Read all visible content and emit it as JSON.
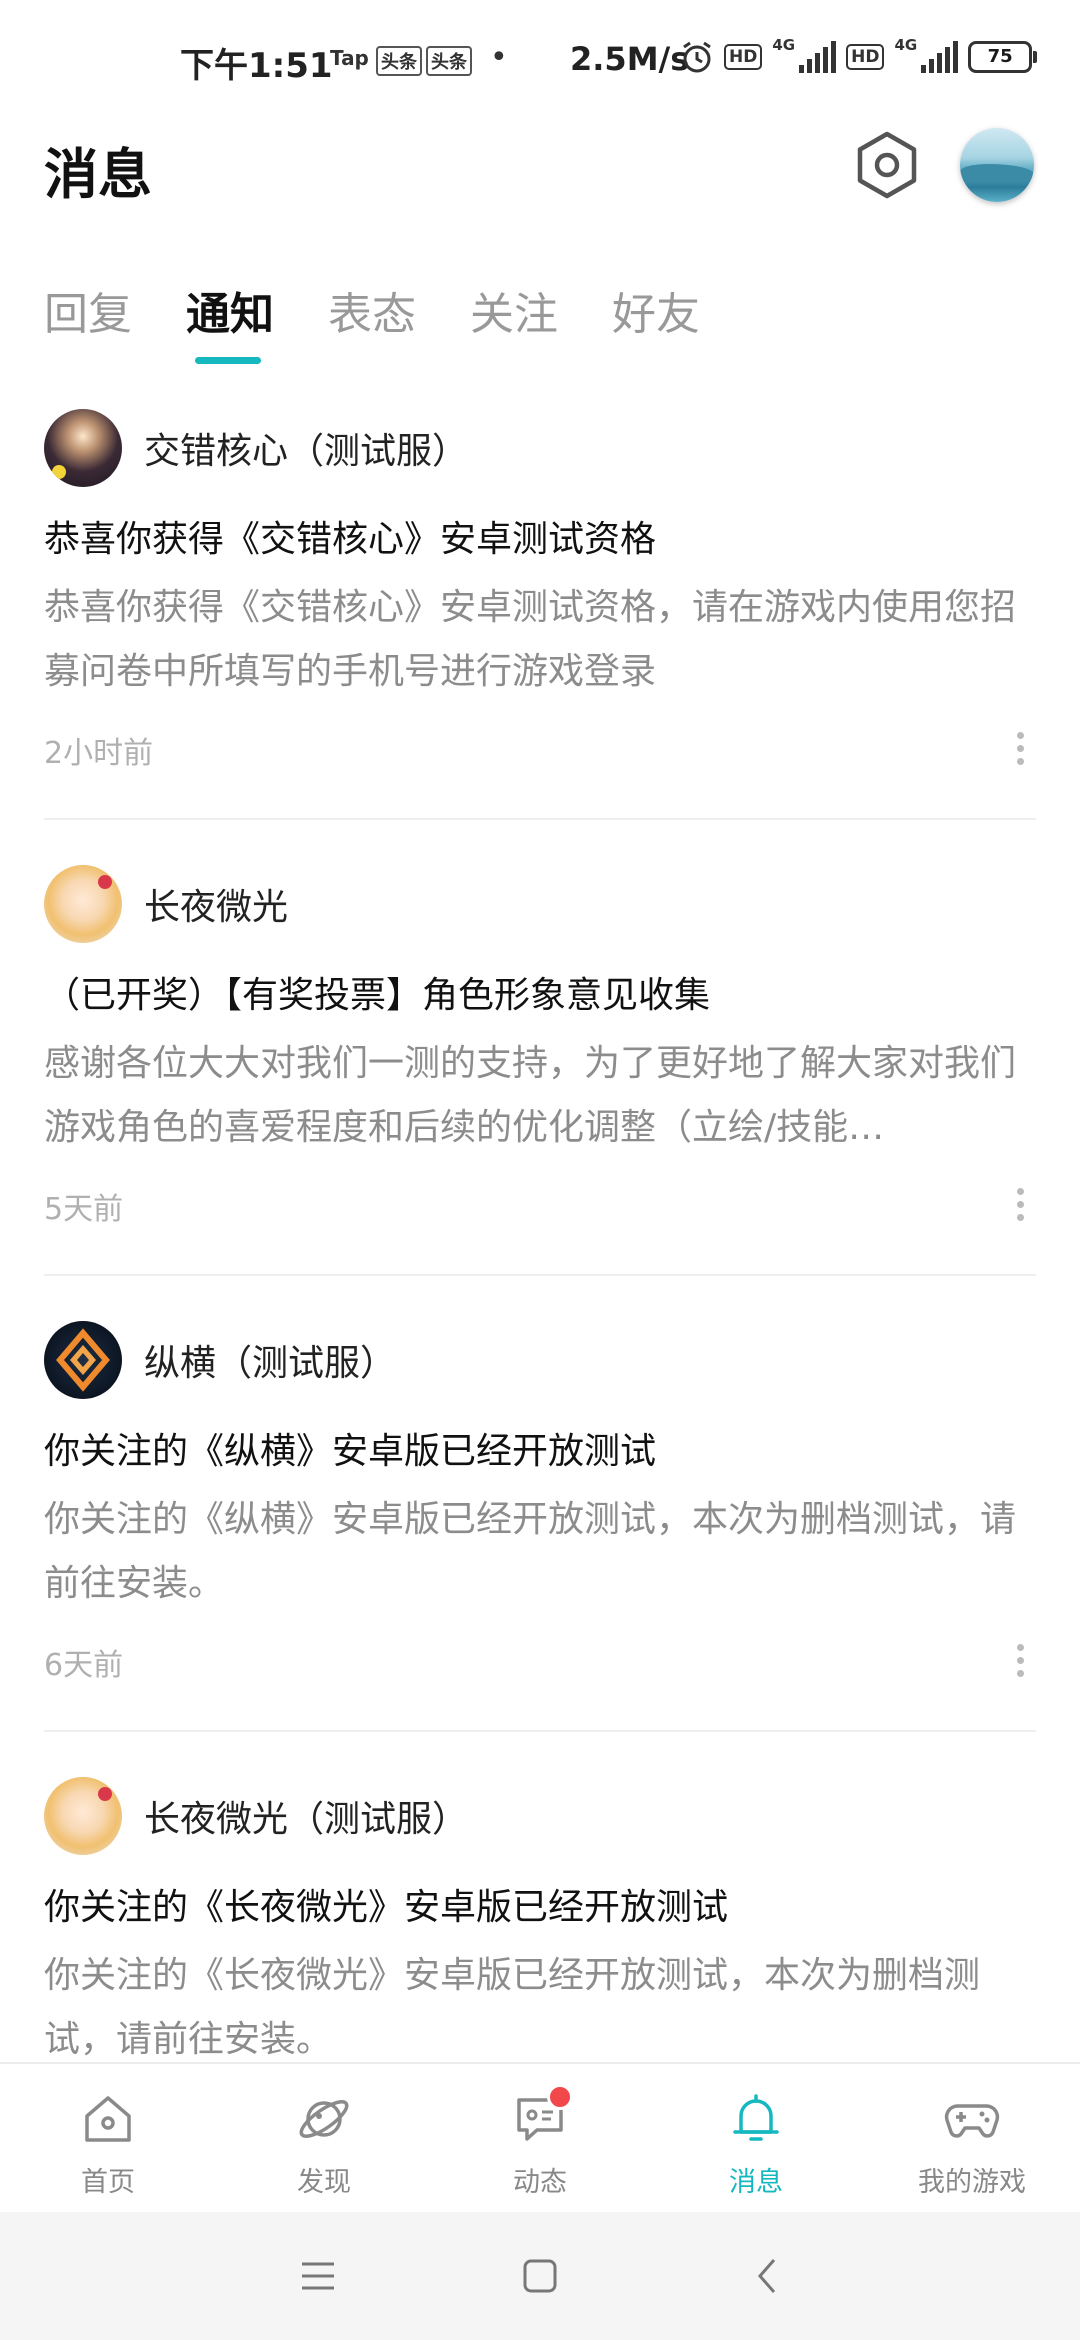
{
  "status_bar": {
    "time": "下午1:51",
    "badges": [
      "Tap",
      "头条",
      "头条"
    ],
    "dot": "•",
    "speed": "2.5M/s",
    "hd": "HD",
    "network": "4G",
    "battery": "75"
  },
  "header": {
    "title": "消息"
  },
  "tabs": [
    {
      "label": "回复"
    },
    {
      "label": "通知"
    },
    {
      "label": "表态"
    },
    {
      "label": "关注"
    },
    {
      "label": "好友"
    }
  ],
  "active_tab": "通知",
  "notifications": [
    {
      "source": "交错核心（测试服）",
      "title": "恭喜你获得《交错核心》安卓测试资格",
      "body": "恭喜你获得《交错核心》安卓测试资格，请在游戏内使用您招募问卷中所填写的手机号进行游戏登录",
      "time": "2小时前"
    },
    {
      "source": "长夜微光",
      "title": "（已开奖）【有奖投票】角色形象意见收集",
      "body": "感谢各位大大对我们一测的支持，为了更好地了解大家对我们游戏角色的喜爱程度和后续的优化调整（立绘/技能…",
      "time": "5天前"
    },
    {
      "source": "纵横（测试服）",
      "title": "你关注的《纵横》安卓版已经开放测试",
      "body": "你关注的《纵横》安卓版已经开放测试，本次为删档测试，请前往安装。",
      "time": "6天前"
    },
    {
      "source": "长夜微光（测试服）",
      "title": "你关注的《长夜微光》安卓版已经开放测试",
      "body": "你关注的《长夜微光》安卓版已经开放测试，本次为删档测试，请前往安装。"
    }
  ],
  "bottom_nav": [
    {
      "label": "首页",
      "icon": "home-icon"
    },
    {
      "label": "发现",
      "icon": "planet-icon"
    },
    {
      "label": "动态",
      "icon": "chat-icon"
    },
    {
      "label": "消息",
      "icon": "bell-icon"
    },
    {
      "label": "我的游戏",
      "icon": "gamepad-icon"
    }
  ],
  "colors": {
    "accent": "#15b8bf",
    "badge_red": "#f2474b",
    "secondary_text": "#8c8c8c"
  }
}
